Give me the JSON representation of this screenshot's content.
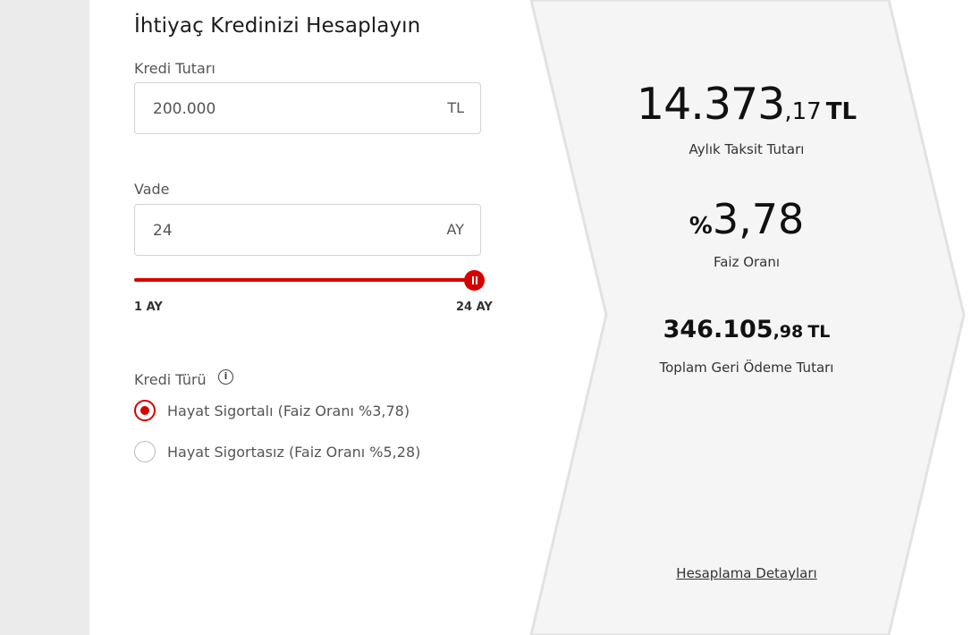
{
  "form": {
    "title": "İhtiyaç Kredinizi Hesaplayın",
    "amount_label": "Kredi Tutarı",
    "amount_value": "200.000",
    "amount_unit": "TL",
    "term_label": "Vade",
    "term_value": "24",
    "term_unit": "AY",
    "slider": {
      "min_label": "1 AY",
      "max_label": "24 AY",
      "min": 1,
      "max": 24,
      "value": 24
    },
    "type_label": "Kredi Türü",
    "info_icon": "info-icon",
    "options": [
      {
        "label": "Hayat Sigortalı (Faiz Oranı %3,78)",
        "checked": true
      },
      {
        "label": "Hayat Sigortasız (Faiz Oranı %5,28)",
        "checked": false
      }
    ]
  },
  "results": {
    "monthly": {
      "main": "14.373",
      "decimal": ",17",
      "currency": "TL",
      "label": "Aylık Taksit Tutarı"
    },
    "rate": {
      "prefix": "%",
      "value": "3,78",
      "label": "Faiz Oranı"
    },
    "total": {
      "main": "346.105",
      "decimal": ",98",
      "currency": "TL",
      "label": "Toplam Geri Ödeme Tutarı"
    },
    "details_link": "Hesaplama Detayları"
  },
  "colors": {
    "accent": "#d50000",
    "panel": "#f5f5f5",
    "gutter": "#ebebeb"
  }
}
